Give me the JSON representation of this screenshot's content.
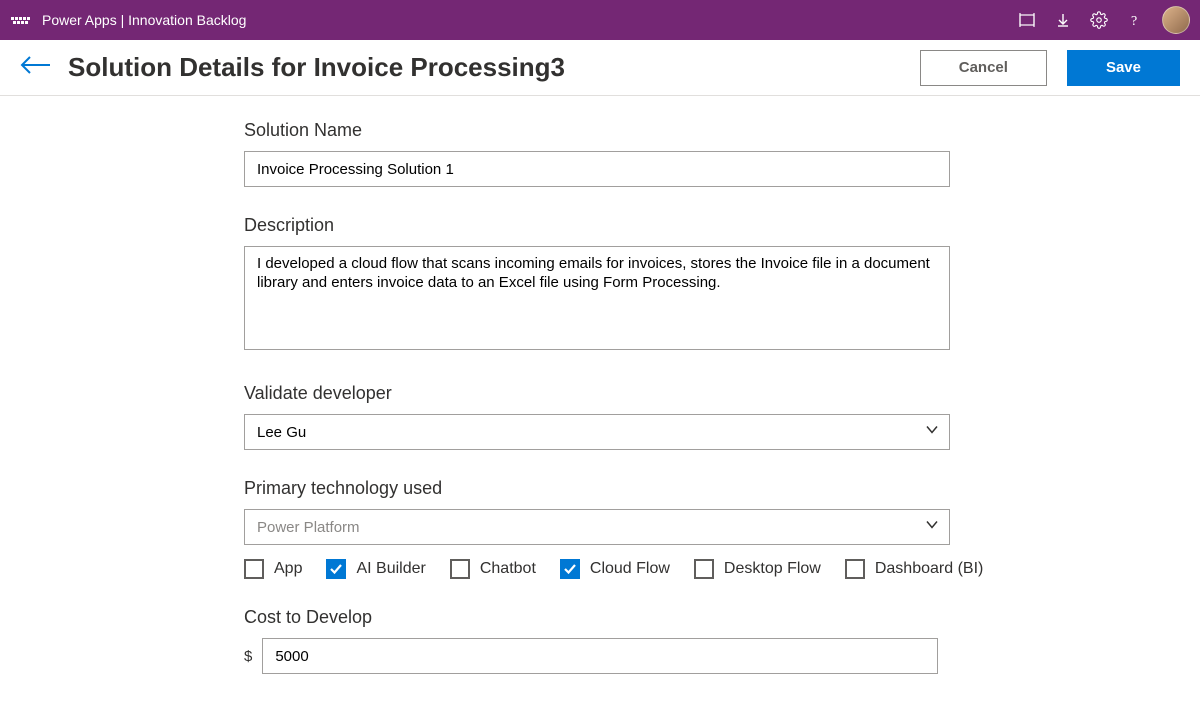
{
  "topbar": {
    "title": "Power Apps  |  Innovation Backlog"
  },
  "header": {
    "title": "Solution Details for Invoice Processing3",
    "cancel": "Cancel",
    "save": "Save"
  },
  "form": {
    "solution_name_label": "Solution Name",
    "solution_name_value": "Invoice Processing Solution 1",
    "description_label": "Description",
    "description_value": "I developed a cloud flow that scans incoming emails for invoices, stores the Invoice file in a document library and enters invoice data to an Excel file using Form Processing.",
    "validate_developer_label": "Validate developer",
    "validate_developer_value": "Lee Gu",
    "primary_tech_label": "Primary technology used",
    "primary_tech_value": "Power Platform",
    "checkboxes": {
      "app": "App",
      "ai_builder": "AI Builder",
      "chatbot": "Chatbot",
      "cloud_flow": "Cloud Flow",
      "desktop_flow": "Desktop Flow",
      "dashboard": "Dashboard (BI)"
    },
    "cost_label": "Cost to Develop",
    "currency": "$",
    "cost_value": "5000"
  }
}
